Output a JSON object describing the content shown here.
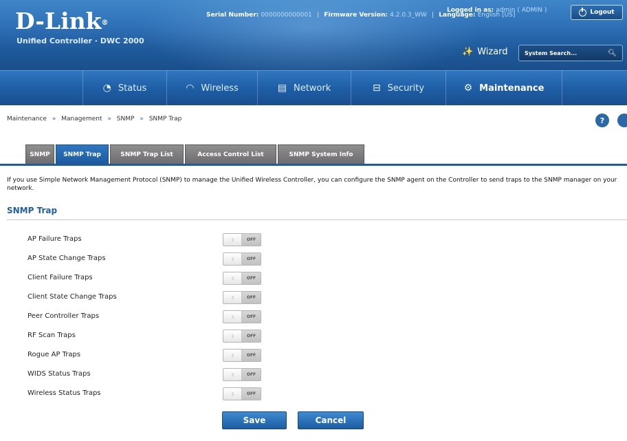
{
  "header": {
    "brand": "D-Link",
    "brand_mark": "®",
    "product": "Unified Controller · DWC 2000",
    "serial_label": "Serial Number:",
    "serial_value": "0000000000001",
    "firmware_label": "Firmware Version:",
    "firmware_value": "4.2.0.3_WW",
    "language_label": "Language:",
    "language_value": "English [US]",
    "logged_label": "Logged in as:",
    "logged_value": "admin ( ADMIN )",
    "logout_label": "Logout",
    "wizard_label": "Wizard",
    "search_placeholder": "System Search...",
    "separator": "|"
  },
  "nav": {
    "items": [
      {
        "label": "Status",
        "icon": "gauge-icon"
      },
      {
        "label": "Wireless",
        "icon": "wifi-icon"
      },
      {
        "label": "Network",
        "icon": "network-icon"
      },
      {
        "label": "Security",
        "icon": "lock-icon"
      },
      {
        "label": "Maintenance",
        "icon": "gear-icon",
        "active": true
      }
    ]
  },
  "breadcrumb": {
    "items": [
      "Maintenance",
      "Management",
      "SNMP",
      "SNMP Trap"
    ],
    "separator": "»"
  },
  "help": {
    "icon_label": "?"
  },
  "tabs": [
    {
      "label": "SNMP"
    },
    {
      "label": "SNMP Trap",
      "active": true
    },
    {
      "label": "SNMP Trap List"
    },
    {
      "label": "Access Control List"
    },
    {
      "label": "SNMP System Info"
    }
  ],
  "description": "If you use Simple Network Management Protocol (SNMP) to manage the Unified Wireless Controller, you can configure the SNMP agent on the Controller to send traps to the SNMP manager on your network.",
  "section_title": "SNMP Trap",
  "traps": [
    {
      "label": "AP Failure Traps",
      "state": "OFF"
    },
    {
      "label": "AP State Change Traps",
      "state": "OFF"
    },
    {
      "label": "Client Failure Traps",
      "state": "OFF"
    },
    {
      "label": "Client State Change Traps",
      "state": "OFF"
    },
    {
      "label": "Peer Controller Traps",
      "state": "OFF"
    },
    {
      "label": "RF Scan Traps",
      "state": "OFF"
    },
    {
      "label": "Rogue AP Traps",
      "state": "OFF"
    },
    {
      "label": "WIDS Status Traps",
      "state": "OFF"
    },
    {
      "label": "Wireless Status Traps",
      "state": "OFF"
    }
  ],
  "buttons": {
    "save": "Save",
    "cancel": "Cancel"
  },
  "colors": {
    "accent": "#1f5fa4",
    "header": "#2f72b8",
    "tab_inactive": "#7d7d7d"
  }
}
